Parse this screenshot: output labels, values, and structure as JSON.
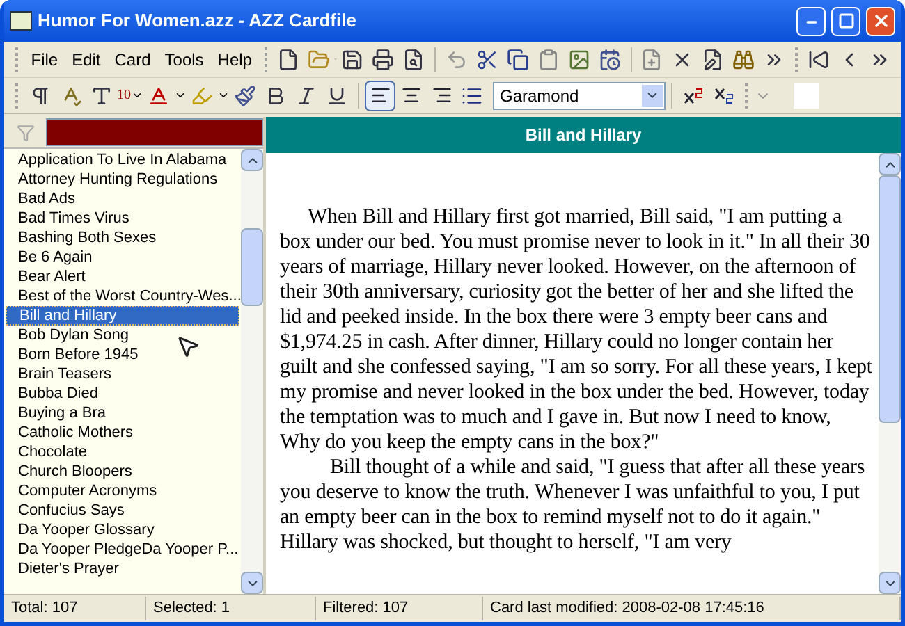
{
  "window": {
    "title": "Humor For Women.azz - AZZ Cardfile"
  },
  "menu": [
    "File",
    "Edit",
    "Card",
    "Tools",
    "Help"
  ],
  "format_toolbar": {
    "font_size": "10",
    "font_name": "Garamond",
    "align_buttons": [
      {
        "kind": "left",
        "selected": true
      },
      {
        "kind": "center",
        "selected": false
      },
      {
        "kind": "right",
        "selected": false
      }
    ]
  },
  "list": {
    "items": [
      {
        "label": "Application To Live In Alabama",
        "selected": false
      },
      {
        "label": "Attorney Hunting Regulations",
        "selected": false
      },
      {
        "label": "Bad Ads",
        "selected": false
      },
      {
        "label": "Bad Times Virus",
        "selected": false
      },
      {
        "label": "Bashing Both Sexes",
        "selected": false
      },
      {
        "label": "Be 6 Again",
        "selected": false
      },
      {
        "label": "Bear Alert",
        "selected": false
      },
      {
        "label": "Best of the Worst Country-Wes...",
        "selected": false
      },
      {
        "label": "Bill and Hillary",
        "selected": true
      },
      {
        "label": "Bob Dylan Song",
        "selected": false
      },
      {
        "label": "Born Before 1945",
        "selected": false
      },
      {
        "label": "Brain Teasers",
        "selected": false
      },
      {
        "label": "Bubba Died",
        "selected": false
      },
      {
        "label": "Buying a Bra",
        "selected": false
      },
      {
        "label": "Catholic Mothers",
        "selected": false
      },
      {
        "label": "Chocolate",
        "selected": false
      },
      {
        "label": "Church Bloopers",
        "selected": false
      },
      {
        "label": "Computer Acronyms",
        "selected": false
      },
      {
        "label": "Confucius Says",
        "selected": false
      },
      {
        "label": "Da Yooper Glossary",
        "selected": false
      },
      {
        "label": "Da Yooper PledgeDa Yooper P...",
        "selected": false
      },
      {
        "label": "Dieter's Prayer",
        "selected": false
      }
    ]
  },
  "card": {
    "title": "Bill and Hillary",
    "paragraphs": [
      "When Bill and Hillary first got married, Bill said, \"I am putting a box under our bed. You must promise never to look in it.\" In all their 30 years of marriage, Hillary never looked. However, on the afternoon of their 30th anniversary, curiosity got the better of her and she lifted the lid and peeked inside. In the box there were 3 empty beer cans and $1,974.25 in cash. After dinner, Hillary could no longer contain her guilt and she confessed saying, \"I am so sorry. For all these years, I kept my promise and never looked in the box under the bed. However, today the temptation was to much and I gave in. But now I need to know, Why do you keep the empty cans in the box?\"",
      "Bill thought of a while and said, \"I guess that after all these years you deserve to know the truth. Whenever I was unfaithful to you, I put an empty beer can in the box to remind myself not to do it again.\" Hillary was shocked, but thought to herself, \"I am very"
    ]
  },
  "status_bar": [
    "Total: 107",
    "Selected: 1",
    "Filtered: 107",
    "Card last modified: 2008-02-08  17:45:16"
  ]
}
